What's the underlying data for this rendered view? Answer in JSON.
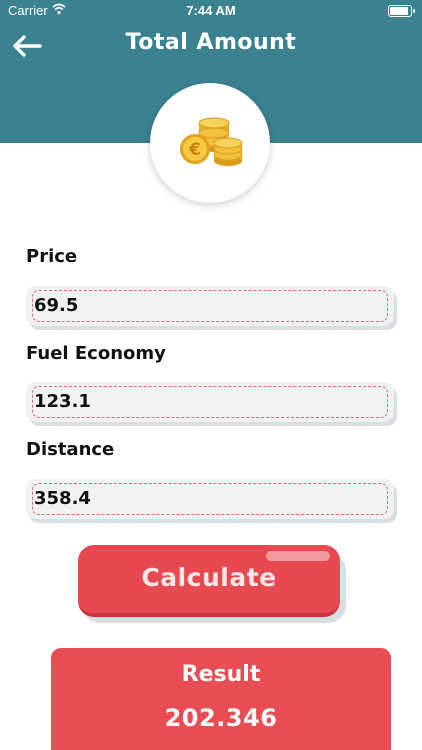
{
  "status_bar": {
    "carrier": "Carrier",
    "time": "7:44 AM"
  },
  "header": {
    "title": "Total Amount",
    "back_icon": "arrow-left-icon",
    "background_color": "#3b8291"
  },
  "hero": {
    "icon": "coins-euro-icon"
  },
  "form": {
    "price": {
      "label": "Price",
      "value": "69.5"
    },
    "fuel_economy": {
      "label": "Fuel Economy",
      "value": "123.1"
    },
    "distance": {
      "label": "Distance",
      "value": "358.4"
    }
  },
  "calculate_button": {
    "label": "Calculate",
    "color": "#e64a50"
  },
  "result": {
    "label": "Result",
    "value": "202.346",
    "color": "#e94d54"
  }
}
